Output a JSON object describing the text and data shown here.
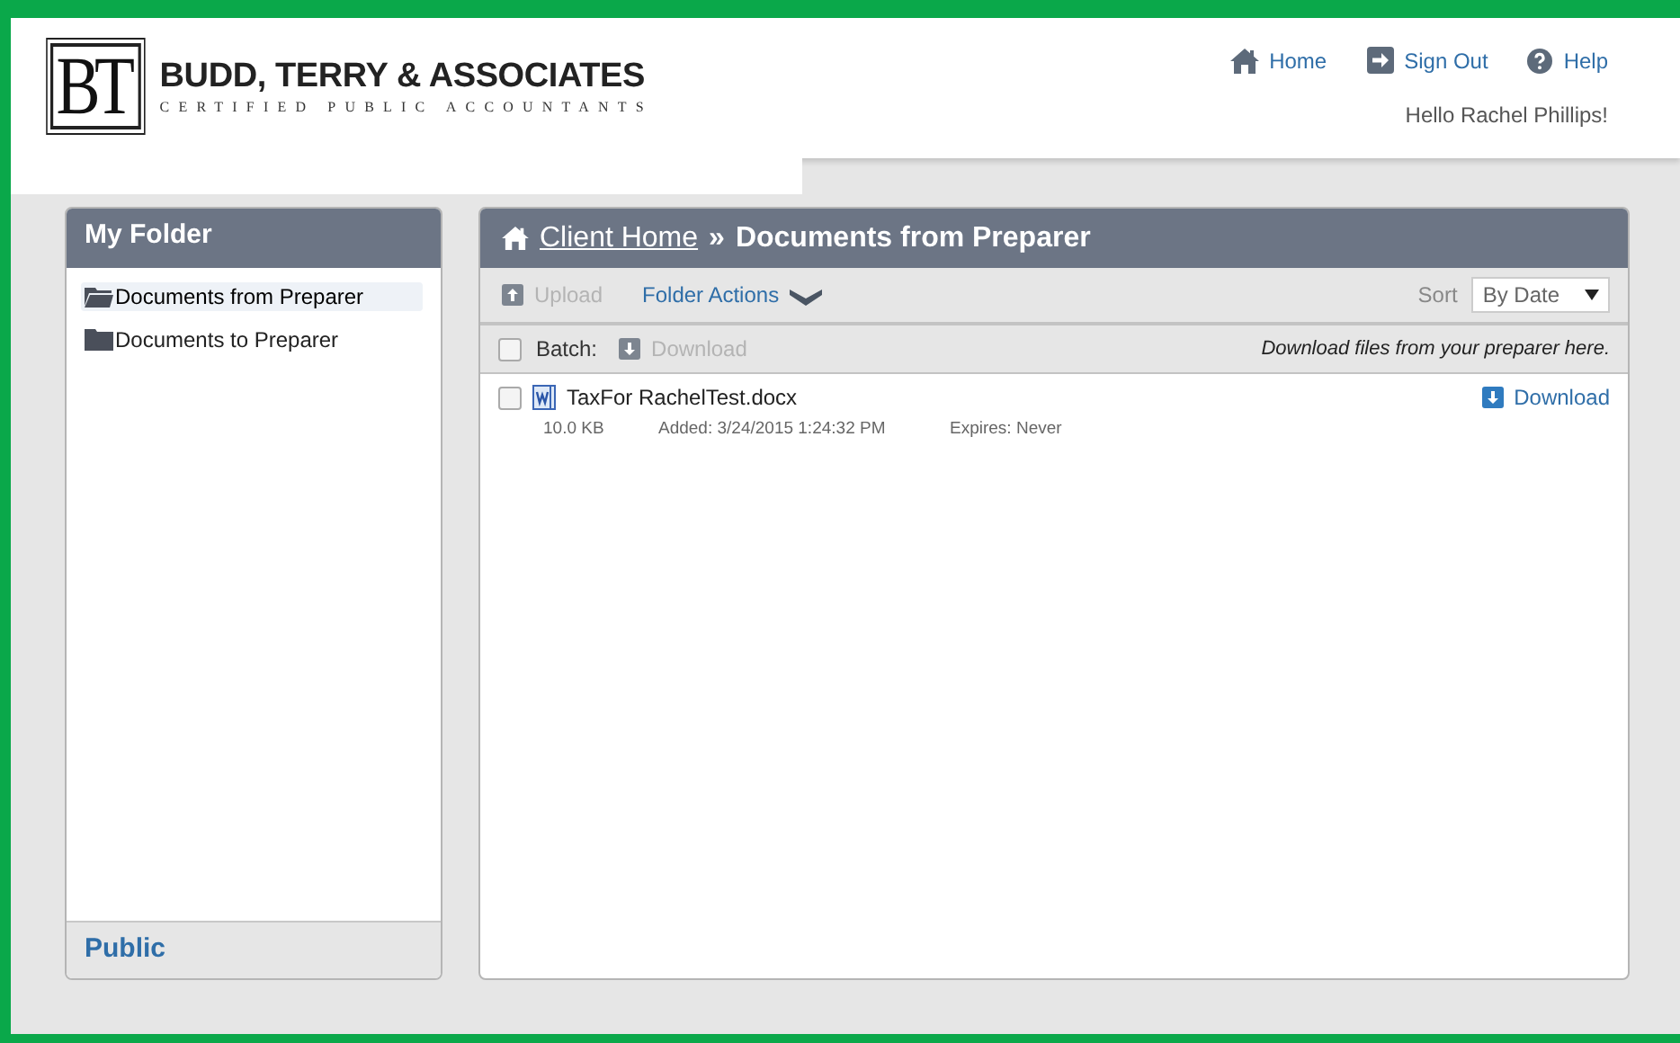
{
  "logo": {
    "monogram": "BT",
    "name": "BUDD, TERRY & ASSOCIATES",
    "tagline": "CERTIFIED PUBLIC ACCOUNTANTS"
  },
  "top_nav": [
    {
      "label": "Home",
      "kind": "home"
    },
    {
      "label": "Sign Out",
      "kind": "signout"
    },
    {
      "label": "Help",
      "kind": "help"
    }
  ],
  "greeting": "Hello Rachel Phillips!",
  "sidebar": {
    "title": "My Folder",
    "items": [
      {
        "label": "Documents from Preparer",
        "selected": true
      },
      {
        "label": "Documents to Preparer",
        "selected": false
      }
    ],
    "footer": "Public"
  },
  "main": {
    "breadcrumb_link": "Client Home",
    "breadcrumb_sep": "»",
    "breadcrumb_current": "Documents from Preparer",
    "toolbar": {
      "upload": {
        "label": "Upload",
        "disabled": true
      },
      "folder_actions": "Folder Actions",
      "sort_label": "Sort",
      "sort_value": "By Date"
    },
    "batch": {
      "label": "Batch:",
      "checked": false,
      "download": {
        "label": "Download",
        "disabled": true
      },
      "hint": "Download files from your preparer here."
    },
    "files": [
      {
        "name": "TaxFor RachelTest.docx",
        "checked": false,
        "size": "10.0 KB",
        "added": "Added: 3/24/2015 1:24:32 PM",
        "expires": "Expires: Never",
        "download": "Download"
      }
    ]
  }
}
